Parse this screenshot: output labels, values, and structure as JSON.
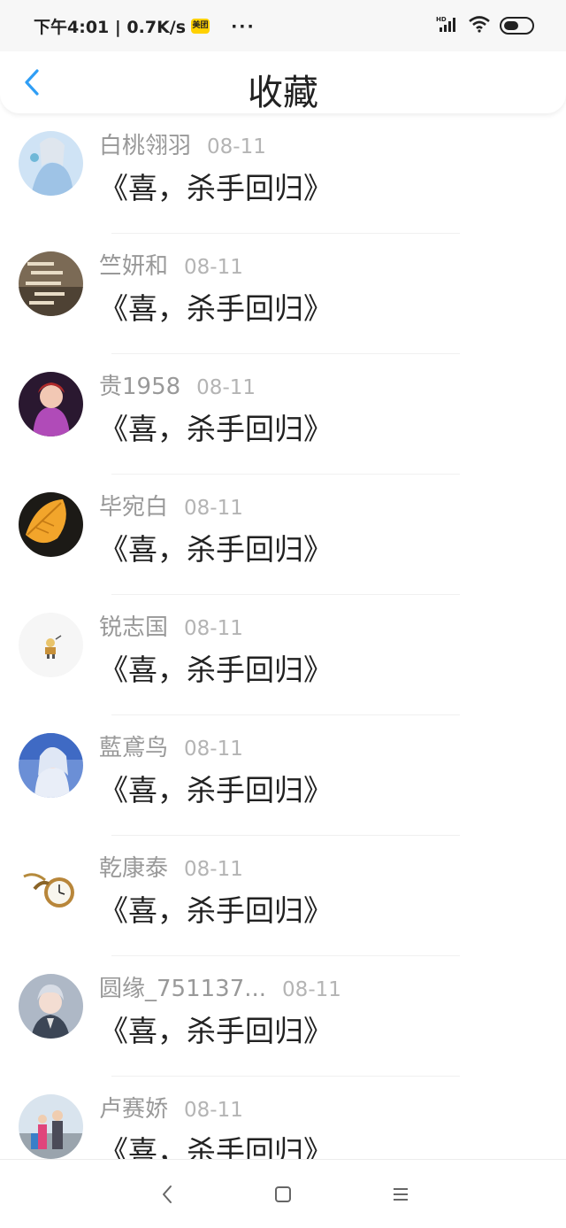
{
  "status_bar": {
    "time_text": "下午4:01 | 0.7K/s",
    "meituan_badge": "美团",
    "more_dots": "···",
    "battery_level": 0.55
  },
  "header": {
    "title": "收藏"
  },
  "colors": {
    "accent": "#2f9ef5",
    "name_text": "#999999",
    "date_text": "#b4b4b4",
    "content_text": "#222222"
  },
  "items": [
    {
      "name": "白桃翎羽",
      "date": "08-11",
      "content": "《喜，杀手回归》"
    },
    {
      "name": "竺妍和",
      "date": "08-11",
      "content": "《喜，杀手回归》"
    },
    {
      "name": "贵1958",
      "date": "08-11",
      "content": "《喜，杀手回归》"
    },
    {
      "name": "毕宛白",
      "date": "08-11",
      "content": "《喜，杀手回归》"
    },
    {
      "name": "锐志国",
      "date": "08-11",
      "content": "《喜，杀手回归》"
    },
    {
      "name": "藍鳶鸟",
      "date": "08-11",
      "content": "《喜，杀手回归》"
    },
    {
      "name": "乾康泰",
      "date": "08-11",
      "content": "《喜，杀手回归》"
    },
    {
      "name": "圆缘_751137...",
      "date": "08-11",
      "content": "《喜，杀手回归》"
    },
    {
      "name": "卢赛娇",
      "date": "08-11",
      "content": "《喜，杀手回归》"
    }
  ],
  "nav": {
    "icons": [
      "back-triangle-icon",
      "home-square-icon",
      "menu-lines-icon"
    ]
  }
}
